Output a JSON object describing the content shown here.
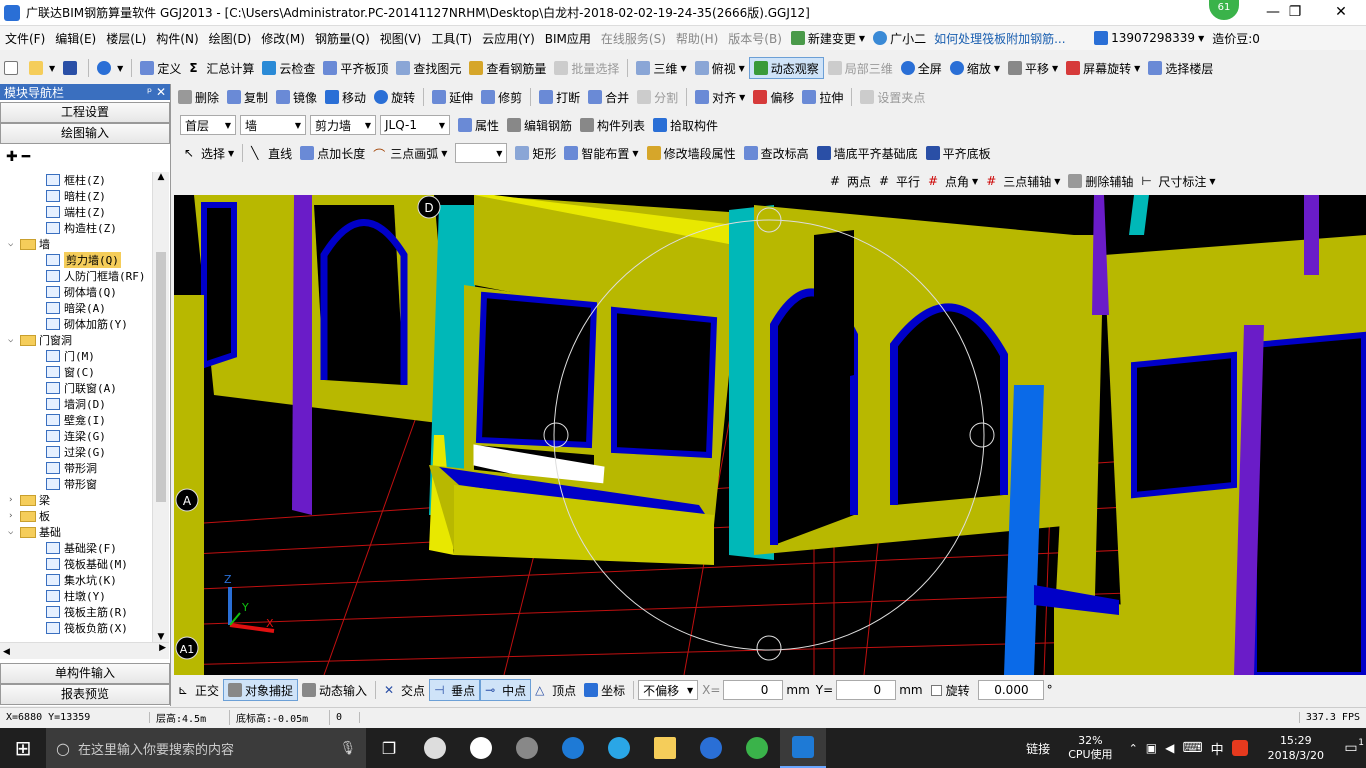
{
  "titlebar": {
    "title": "广联达BIM钢筋算量软件 GGJ2013 - [C:\\Users\\Administrator.PC-20141127NRHM\\Desktop\\白龙村-2018-02-02-19-24-35(2666版).GGJ12]",
    "badge": "61",
    "minimize": "—",
    "restore": "❐",
    "close": "✕"
  },
  "menu": [
    "文件(F)",
    "编辑(E)",
    "楼层(L)",
    "构件(N)",
    "绘图(D)",
    "修改(M)",
    "钢筋量(Q)",
    "视图(V)",
    "工具(T)",
    "云应用(Y)",
    "BIM应用",
    "在线服务(S)",
    "帮助(H)",
    "版本号(B)"
  ],
  "menu_right": {
    "new_change": "新建变更",
    "assistant": "广小二",
    "question": "如何处理筏板附加钢筋...",
    "phone": "13907298339",
    "points": "造价豆:0"
  },
  "toolbar1": [
    "定义",
    "汇总计算",
    "云检查",
    "平齐板顶",
    "查找图元",
    "查看钢筋量",
    "批量选择",
    "三维",
    "俯视",
    "动态观察",
    "局部三维",
    "全屏",
    "缩放",
    "平移",
    "屏幕旋转",
    "选择楼层"
  ],
  "toolbar2": [
    "删除",
    "复制",
    "镜像",
    "移动",
    "旋转",
    "延伸",
    "修剪",
    "打断",
    "合并",
    "分割",
    "对齐",
    "偏移",
    "拉伸",
    "设置夹点"
  ],
  "toolbar3": {
    "floor": "首层",
    "type": "墙",
    "subtype": "剪力墙",
    "element": "JLQ-1",
    "items": [
      "属性",
      "编辑钢筋",
      "构件列表",
      "拾取构件"
    ]
  },
  "toolbar4": [
    "选择",
    "直线",
    "点加长度",
    "三点画弧",
    "矩形",
    "智能布置",
    "修改墙段属性",
    "查改标高",
    "墙底平齐基础底",
    "平齐底板"
  ],
  "toolbar5": [
    "两点",
    "平行",
    "点角",
    "三点辅轴",
    "删除辅轴",
    "尺寸标注"
  ],
  "sidebar": {
    "title": "模块导航栏",
    "pin": "ᵖ ✕",
    "btn_settings": "工程设置",
    "btn_draw": "绘图输入",
    "btn_single": "单构件输入",
    "btn_report": "报表预览",
    "tree": [
      {
        "t": "item",
        "label": "框柱(Z)"
      },
      {
        "t": "item",
        "label": "暗柱(Z)"
      },
      {
        "t": "item",
        "label": "端柱(Z)"
      },
      {
        "t": "item",
        "label": "构造柱(Z)"
      },
      {
        "t": "folder",
        "label": "墙",
        "open": true
      },
      {
        "t": "item",
        "label": "剪力墙(Q)",
        "selected": true
      },
      {
        "t": "item",
        "label": "人防门框墙(RF)"
      },
      {
        "t": "item",
        "label": "砌体墙(Q)"
      },
      {
        "t": "item",
        "label": "暗梁(A)"
      },
      {
        "t": "item",
        "label": "砌体加筋(Y)"
      },
      {
        "t": "folder",
        "label": "门窗洞",
        "open": true
      },
      {
        "t": "item",
        "label": "门(M)"
      },
      {
        "t": "item",
        "label": "窗(C)"
      },
      {
        "t": "item",
        "label": "门联窗(A)"
      },
      {
        "t": "item",
        "label": "墙洞(D)"
      },
      {
        "t": "item",
        "label": "壁龛(I)"
      },
      {
        "t": "item",
        "label": "连梁(G)"
      },
      {
        "t": "item",
        "label": "过梁(G)"
      },
      {
        "t": "item",
        "label": "带形洞"
      },
      {
        "t": "item",
        "label": "带形窗"
      },
      {
        "t": "folder",
        "label": "梁",
        "open": false
      },
      {
        "t": "folder",
        "label": "板",
        "open": false
      },
      {
        "t": "folder",
        "label": "基础",
        "open": true
      },
      {
        "t": "item",
        "label": "基础梁(F)"
      },
      {
        "t": "item",
        "label": "筏板基础(M)"
      },
      {
        "t": "item",
        "label": "集水坑(K)"
      },
      {
        "t": "item",
        "label": "柱墩(Y)"
      },
      {
        "t": "item",
        "label": "筏板主筋(R)"
      },
      {
        "t": "item",
        "label": "筏板负筋(X)"
      }
    ]
  },
  "viewport": {
    "axis_d": "D",
    "axis_a": "A",
    "axis_a1": "A1",
    "axis_z": "Z",
    "axis_y": "Y",
    "axis_x": "X"
  },
  "snapbar": {
    "items": [
      "正交",
      "对象捕捉",
      "动态输入",
      "交点",
      "垂点",
      "中点",
      "顶点",
      "坐标"
    ],
    "offset": "不偏移",
    "x_label": "X=",
    "x_val": "0",
    "y_label": "Y=",
    "y_val": "0",
    "unit": "mm",
    "rotate": "旋转",
    "rotate_val": "0.000",
    "deg": "°"
  },
  "status": {
    "coords": "X=6880 Y=13359",
    "floor_h": "层高:4.5m",
    "base_h": "底标高:-0.05m",
    "zero": "0",
    "fps": "337.3 FPS"
  },
  "taskbar": {
    "search": "在这里输入你要搜索的内容",
    "link": "链接",
    "cpu_pct": "32%",
    "cpu": "CPU使用",
    "ime": "中",
    "time": "15:29",
    "date": "2018/3/20",
    "notify": "1"
  },
  "colors": {
    "wall": "#b8b800",
    "wall_top": "#e8e800",
    "wall_blue": "#0000c8",
    "cyan": "#00b8b8",
    "purple": "#6a1cc8",
    "grid": "#d01010"
  }
}
